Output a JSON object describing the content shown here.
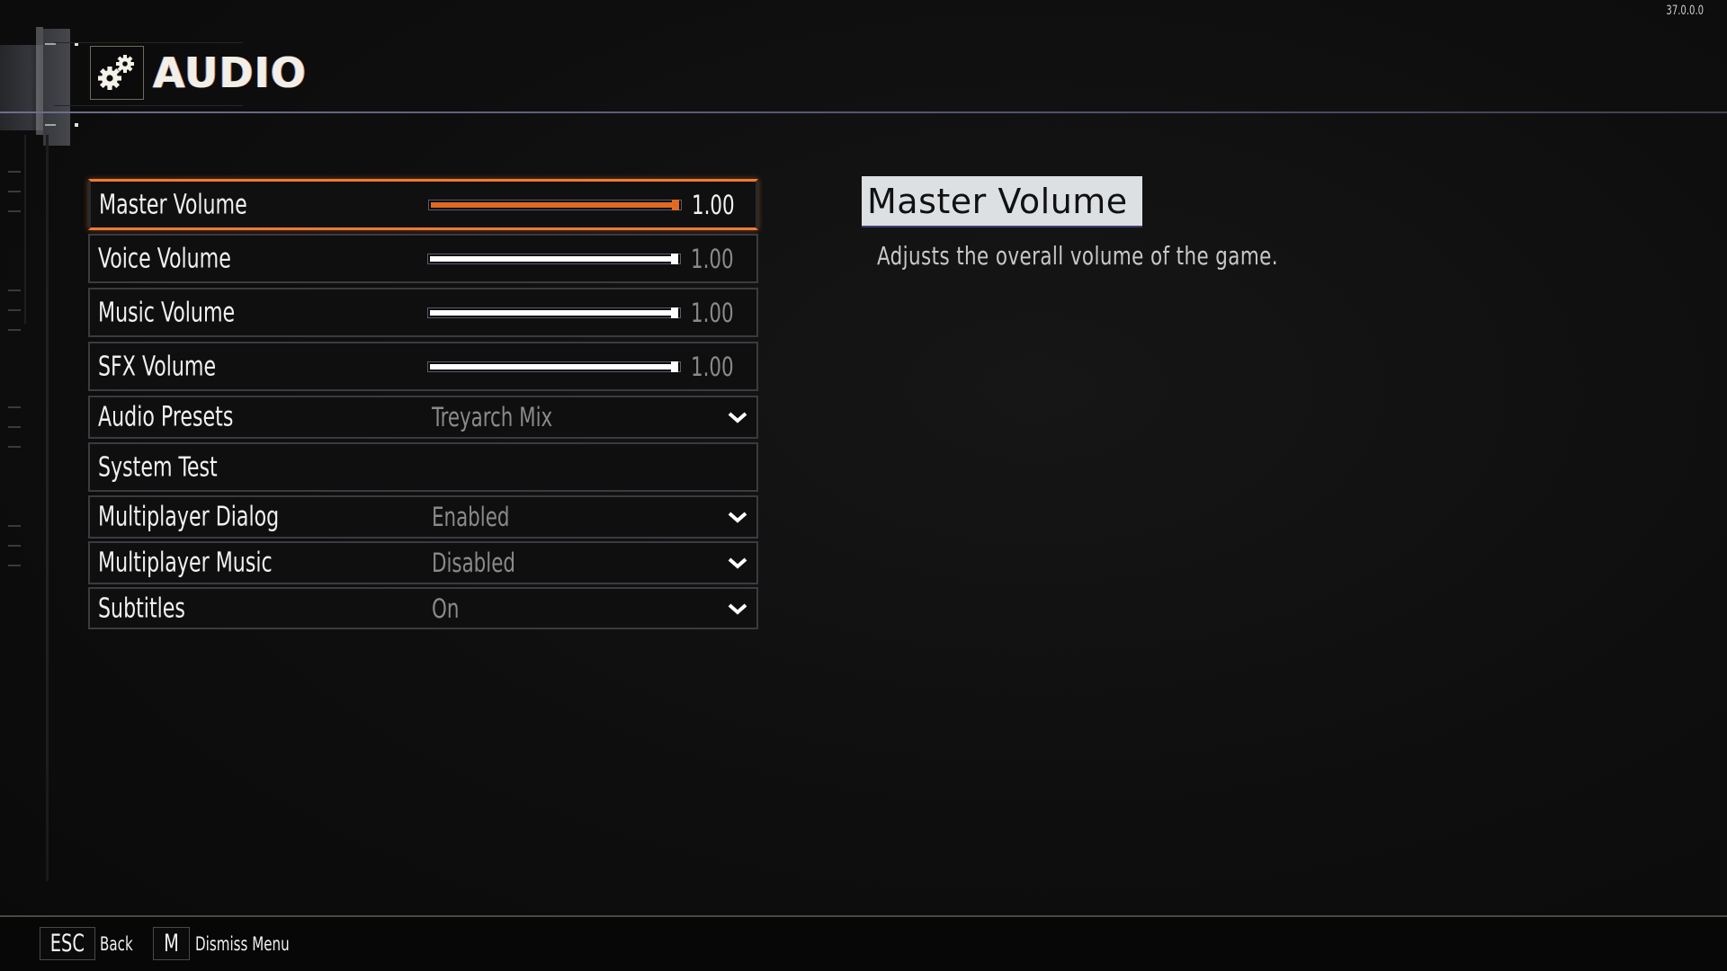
{
  "version": "37.0.0.0",
  "header": {
    "title": "AUDIO",
    "icon": "gears-icon"
  },
  "colors": {
    "accent": "#f07a30",
    "slider_active": "#e06a22",
    "slider_inactive": "#ffffff",
    "row_border": "#3a3b40",
    "header_line": "#5c5f80"
  },
  "settings": [
    {
      "label": "Master Volume",
      "type": "slider",
      "value": 1.0,
      "display": "1.00",
      "selected": true
    },
    {
      "label": "Voice Volume",
      "type": "slider",
      "value": 1.0,
      "display": "1.00"
    },
    {
      "label": "Music Volume",
      "type": "slider",
      "value": 1.0,
      "display": "1.00"
    },
    {
      "label": "SFX Volume",
      "type": "slider",
      "value": 1.0,
      "display": "1.00"
    },
    {
      "label": "Audio Presets",
      "type": "dropdown",
      "display": "Treyarch Mix"
    },
    {
      "label": "System Test",
      "type": "button"
    },
    {
      "label": "Multiplayer Dialog",
      "type": "dropdown",
      "display": "Enabled"
    },
    {
      "label": "Multiplayer Music",
      "type": "dropdown",
      "display": "Disabled"
    },
    {
      "label": "Subtitles",
      "type": "dropdown",
      "display": "On"
    }
  ],
  "description": {
    "title": "Master Volume",
    "text": "Adjusts the overall volume of the game."
  },
  "footer": {
    "hints": [
      {
        "key": "ESC",
        "label": "Back"
      },
      {
        "key": "M",
        "label": "Dismiss Menu"
      }
    ]
  }
}
